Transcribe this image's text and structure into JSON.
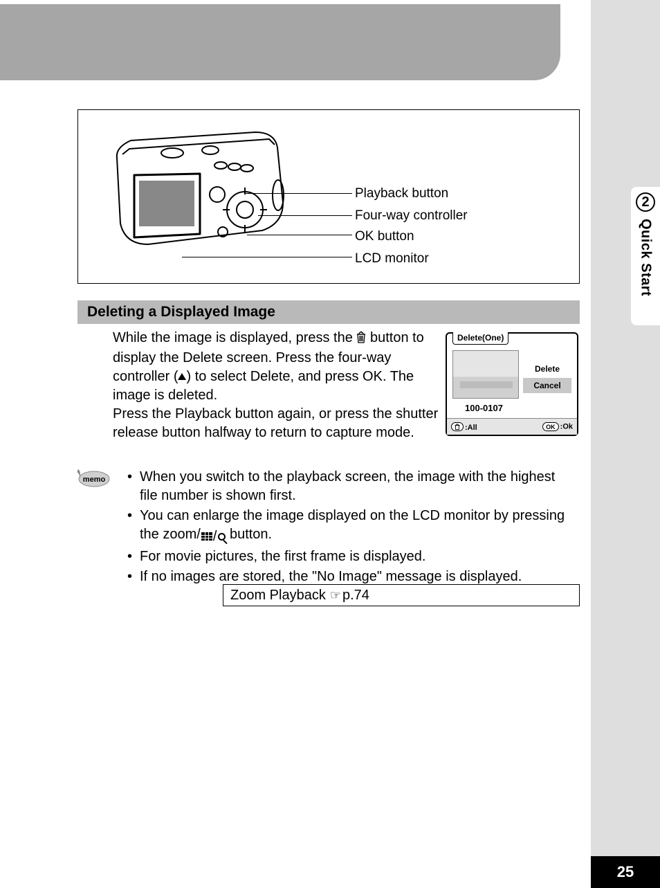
{
  "sidebar": {
    "chapter_number": "2",
    "chapter_title": "Quick Start",
    "page_number": "25"
  },
  "diagram": {
    "labels": {
      "playback": "Playback button",
      "fourway": "Four-way controller",
      "ok": "OK button",
      "lcd": "LCD monitor"
    }
  },
  "section": {
    "heading": "Deleting a Displayed Image",
    "para_part1": "While the image is displayed, press the ",
    "para_part2": " button to display the Delete screen. Press the four-way controller (",
    "para_part3": ") to select Delete, and press OK. The image is deleted.",
    "para_part4": "Press the Playback button again, or press the shutter release button halfway to return to capture mode."
  },
  "delete_screen": {
    "title": "Delete(One)",
    "option_delete": "Delete",
    "option_cancel": "Cancel",
    "file_no": "100-0107",
    "footer_all_label": "All",
    "footer_ok_pill": "OK",
    "footer_ok_label": "Ok"
  },
  "memo": {
    "items": [
      "When you switch to the playback screen, the image with the highest file number is shown first.",
      "You can enlarge the image displayed on the LCD monitor by pressing the zoom/",
      " button.",
      "For movie pictures, the first frame is displayed.",
      "If no images are stored, the \"No Image\" message is displayed."
    ]
  },
  "reference": {
    "text": "Zoom Playback ",
    "page": "p.74"
  }
}
